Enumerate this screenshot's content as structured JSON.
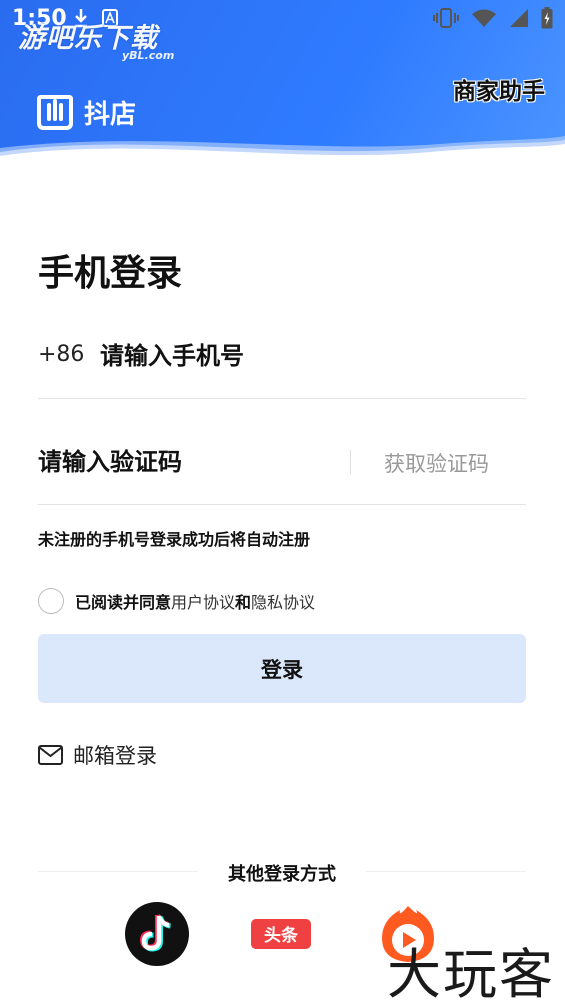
{
  "status_bar": {
    "time": "1:50"
  },
  "watermark_top": {
    "text": "游吧乐下载",
    "sub": "yBL.com"
  },
  "header": {
    "brand_name": "抖店",
    "help_link": "商家助手",
    "colors": {
      "gradient_start": "#2a6cf0",
      "gradient_end": "#4b95ff"
    }
  },
  "form": {
    "title": "手机登录",
    "country_code": "+86",
    "phone_placeholder": "请输入手机号",
    "code_placeholder": "请输入验证码",
    "get_code_label": "获取验证码",
    "notice": "未注册的手机号登录成功后将自动注册",
    "agree_prefix": "已阅读并同意",
    "user_agreement": "用户协议",
    "and": "和",
    "privacy_policy": "隐私协议",
    "login_label": "登录",
    "login_button_color": "#dbe7fb"
  },
  "email_login": {
    "label": "邮箱登录",
    "icon": "mail-icon"
  },
  "other_login": {
    "title": "其他登录方式",
    "providers": [
      {
        "icon": "tiktok-icon"
      },
      {
        "icon": "toutiao-icon",
        "label": "头条"
      },
      {
        "icon": "xigua-icon"
      }
    ]
  },
  "watermark_bottom": {
    "text": "大玩客"
  }
}
